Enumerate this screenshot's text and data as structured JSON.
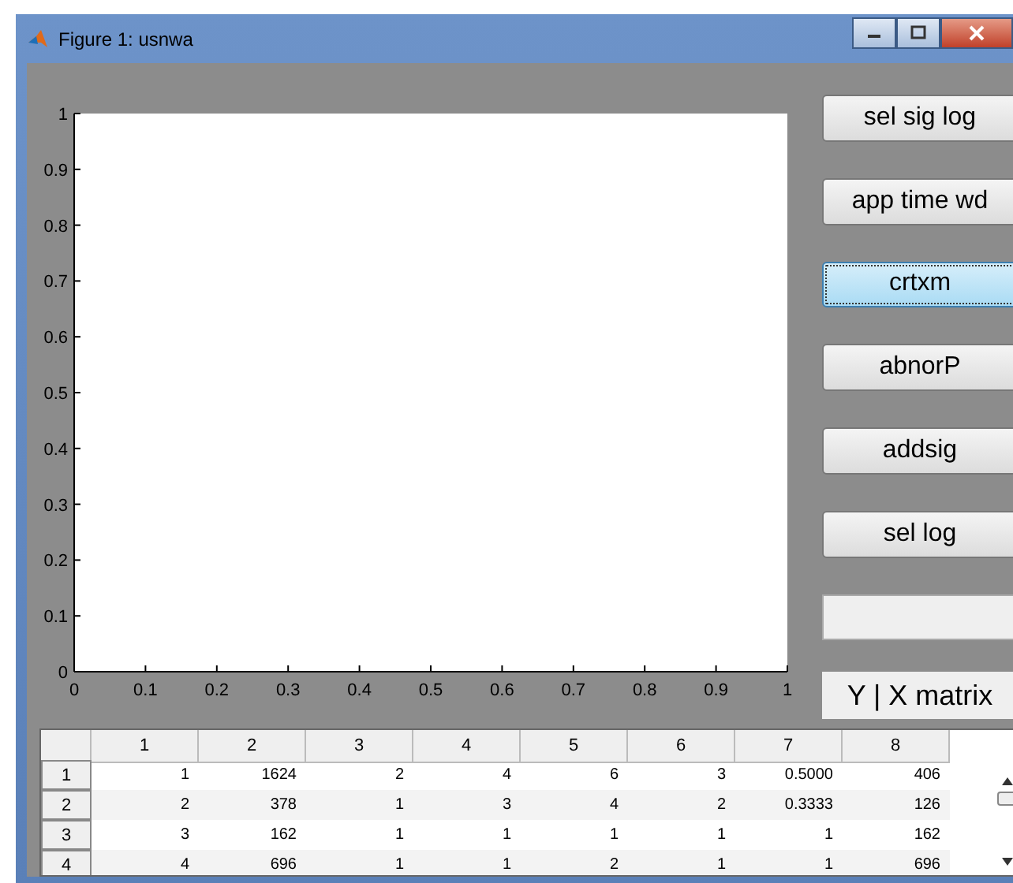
{
  "window": {
    "title": "Figure 1: usnwa"
  },
  "plot": {
    "chart_data": {
      "type": "line",
      "xlim": [
        0,
        1
      ],
      "ylim": [
        0,
        1
      ],
      "xticks": [
        0,
        0.1,
        0.2,
        0.3,
        0.4,
        0.5,
        0.6,
        0.7,
        0.8,
        0.9,
        1
      ],
      "yticks": [
        0,
        0.1,
        0.2,
        0.3,
        0.4,
        0.5,
        0.6,
        0.7,
        0.8,
        0.9,
        1
      ]
    }
  },
  "buttons": [
    {
      "label": "sel sig log",
      "selected": false
    },
    {
      "label": "app time wd",
      "selected": false
    },
    {
      "label": "crtxm",
      "selected": true
    },
    {
      "label": "abnorP",
      "selected": false
    },
    {
      "label": "addsig",
      "selected": false
    },
    {
      "label": "sel log",
      "selected": false
    }
  ],
  "matrix_label": "Y | X matrix",
  "table": {
    "columns": [
      "1",
      "2",
      "3",
      "4",
      "5",
      "6",
      "7",
      "8"
    ],
    "rows": [
      {
        "header": "1",
        "cells": [
          "1",
          "1624",
          "2",
          "4",
          "6",
          "3",
          "0.5000",
          "406"
        ]
      },
      {
        "header": "2",
        "cells": [
          "2",
          "378",
          "1",
          "3",
          "4",
          "2",
          "0.3333",
          "126"
        ]
      },
      {
        "header": "3",
        "cells": [
          "3",
          "162",
          "1",
          "1",
          "1",
          "1",
          "1",
          "162"
        ]
      },
      {
        "header": "4",
        "cells": [
          "4",
          "696",
          "1",
          "1",
          "2",
          "1",
          "1",
          "696"
        ]
      }
    ]
  }
}
